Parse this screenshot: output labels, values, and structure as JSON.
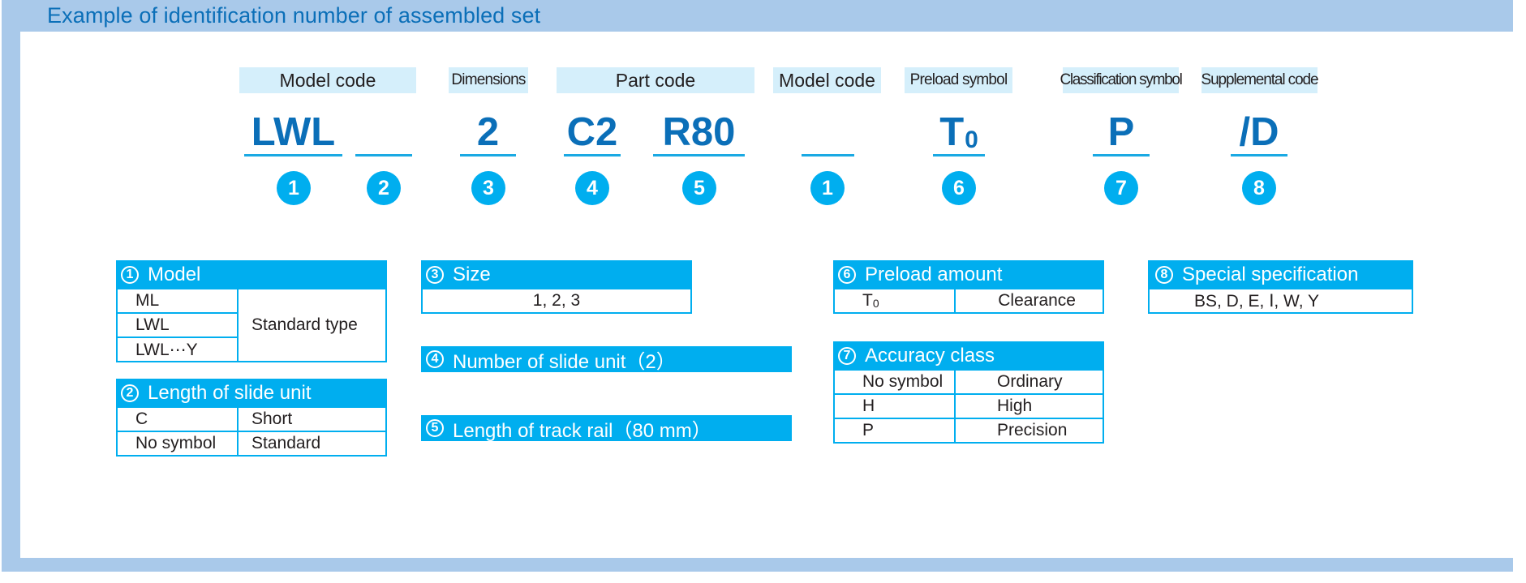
{
  "title": "Example of identification number of assembled set",
  "colors": {
    "frame": "#a9c9ea",
    "title": "#0b6fb8",
    "accent": "#00aeef",
    "label_bg": "#d5effb"
  },
  "code_row": [
    {
      "label": "Model code",
      "label_span": true,
      "code": "LWL",
      "number": "1"
    },
    {
      "label": "",
      "code": "",
      "number": "2"
    },
    {
      "label": "Dimensions",
      "code": "2",
      "number": "3"
    },
    {
      "label": "Part code",
      "label_span": true,
      "code": "C2",
      "number": "4"
    },
    {
      "label": "",
      "code": "R80",
      "number": "5"
    },
    {
      "label": "Model code",
      "code": "",
      "number": "1"
    },
    {
      "label": "Preload symbol",
      "code": "T",
      "code_sub": "0",
      "number": "6"
    },
    {
      "label": "Classification symbol",
      "code": "P",
      "number": "7"
    },
    {
      "label": "Supplemental code",
      "code": "/D",
      "number": "8"
    }
  ],
  "tables": {
    "model": {
      "num": "1",
      "title": "Model",
      "rows": [
        "ML",
        "LWL",
        "LWL⋯Y"
      ],
      "value": "Standard type"
    },
    "length_slide": {
      "num": "2",
      "title": "Length of slide unit",
      "rows": [
        {
          "key": "C",
          "value": "Short"
        },
        {
          "key": "No symbol",
          "value": "Standard"
        }
      ]
    },
    "size": {
      "num": "3",
      "title": "Size",
      "value": "1, 2, 3"
    },
    "slide_count": {
      "num": "4",
      "title": "Number of slide unit（2）"
    },
    "rail_length": {
      "num": "5",
      "title": "Length of track rail（80 mm）"
    },
    "preload": {
      "num": "6",
      "title": "Preload amount",
      "key": "T",
      "key_sub": "0",
      "value": "Clearance"
    },
    "accuracy": {
      "num": "7",
      "title": "Accuracy class",
      "rows": [
        {
          "key": "No symbol",
          "value": "Ordinary"
        },
        {
          "key": "H",
          "value": "High"
        },
        {
          "key": "P",
          "value": "Precision"
        }
      ]
    },
    "special": {
      "num": "8",
      "title": "Special specification",
      "value": "BS, D, E, Ⅰ, W, Y"
    }
  }
}
